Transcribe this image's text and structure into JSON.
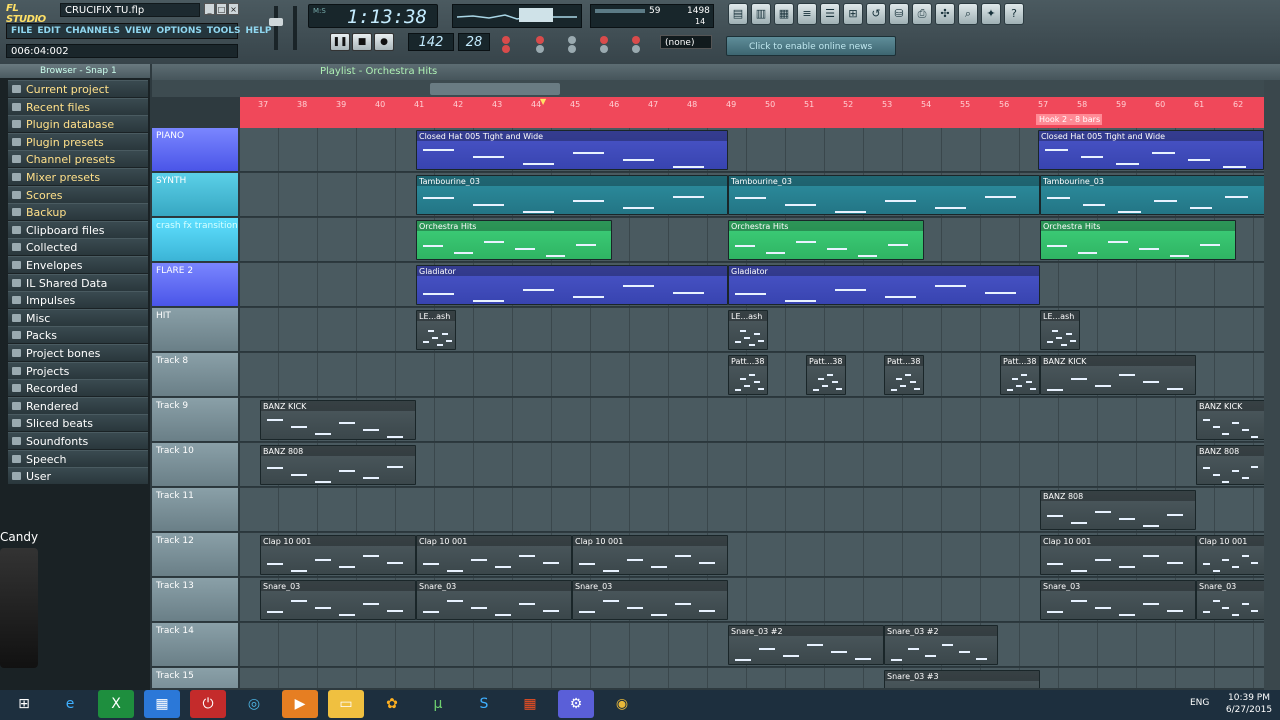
{
  "app": {
    "logo": "FL STUDIO",
    "file": "CRUCIFIX TU.flp"
  },
  "menu": [
    "FILE",
    "EDIT",
    "CHANNELS",
    "VIEW",
    "OPTIONS",
    "TOOLS",
    "HELP"
  ],
  "hint": "006:04:002",
  "time": "1:13:38",
  "pattern": "142",
  "tempo": "28",
  "cpu": {
    "v1": "59",
    "v2": "1498",
    "v3": "14"
  },
  "snap": "(none)",
  "news": "Click to enable online news",
  "browser": {
    "title": "Browser - Snap 1",
    "items": [
      "Current project",
      "Recent files",
      "Plugin database",
      "Plugin presets",
      "Channel presets",
      "Mixer presets",
      "Scores",
      "Backup",
      "Clipboard files",
      "Collected",
      "Envelopes",
      "IL Shared Data",
      "Impulses",
      "Misc",
      "Packs",
      "Project bones",
      "Projects",
      "Recorded",
      "Rendered",
      "Sliced beats",
      "Soundfonts",
      "Speech",
      "User"
    ]
  },
  "candy": "Candy",
  "playlist": {
    "title": "Playlist - Orchestra Hits"
  },
  "ruler": [
    "37",
    "38",
    "39",
    "40",
    "41",
    "42",
    "43",
    "44",
    "45",
    "46",
    "47",
    "48",
    "49",
    "50",
    "51",
    "52",
    "53",
    "54",
    "55",
    "56",
    "57",
    "58",
    "59",
    "60",
    "61",
    "62"
  ],
  "hook": "Hook 2 - 8 bars",
  "tracks": [
    {
      "name": "PIANO",
      "clips": [
        {
          "l": "Closed Hat 005 Tight and Wide"
        },
        {
          "l": "Closed Hat 005 Tight and Wide"
        }
      ]
    },
    {
      "name": "SYNTH",
      "clips": [
        {
          "l": "Tambourine_03"
        },
        {
          "l": "Tambourine_03"
        },
        {
          "l": "Tambourine_03"
        }
      ]
    },
    {
      "name": "crash fx transition",
      "clips": [
        {
          "l": "Orchestra Hits"
        },
        {
          "l": "Orchestra Hits"
        },
        {
          "l": "Orchestra Hits"
        }
      ]
    },
    {
      "name": "FLARE 2",
      "clips": [
        {
          "l": "Gladiator"
        },
        {
          "l": "Gladiator"
        }
      ]
    },
    {
      "name": "HIT",
      "clips": [
        {
          "l": "LE...ash"
        },
        {
          "l": "LE...ash"
        },
        {
          "l": "LE...ash"
        }
      ]
    },
    {
      "name": "Track 8",
      "clips": [
        {
          "l": "Patt...38"
        },
        {
          "l": "Patt...38"
        },
        {
          "l": "Patt...38"
        },
        {
          "l": "Patt...38"
        },
        {
          "l": "BANZ KICK"
        }
      ]
    },
    {
      "name": "Track 9",
      "clips": [
        {
          "l": "BANZ KICK"
        },
        {
          "l": "BANZ KICK"
        }
      ]
    },
    {
      "name": "Track 10",
      "clips": [
        {
          "l": "BANZ 808"
        },
        {
          "l": "BANZ 808"
        }
      ]
    },
    {
      "name": "Track 11",
      "clips": [
        {
          "l": "BANZ 808"
        }
      ]
    },
    {
      "name": "Track 12",
      "clips": [
        {
          "l": "Clap 10 001"
        },
        {
          "l": "Clap 10 001"
        },
        {
          "l": "Clap 10 001"
        },
        {
          "l": "Clap 10 001"
        },
        {
          "l": "Clap 10 001"
        }
      ]
    },
    {
      "name": "Track 13",
      "clips": [
        {
          "l": "Snare_03"
        },
        {
          "l": "Snare_03"
        },
        {
          "l": "Snare_03"
        },
        {
          "l": "Snare_03"
        },
        {
          "l": "Snare_03"
        }
      ]
    },
    {
      "name": "Track 14",
      "clips": [
        {
          "l": "Snare_03 #2"
        },
        {
          "l": "Snare_03 #2"
        }
      ]
    },
    {
      "name": "Track 15",
      "clips": [
        {
          "l": "Snare_03 #3"
        }
      ]
    }
  ],
  "taskbar": {
    "lang": "ENG",
    "time": "10:39 PM",
    "date": "6/27/2015"
  }
}
